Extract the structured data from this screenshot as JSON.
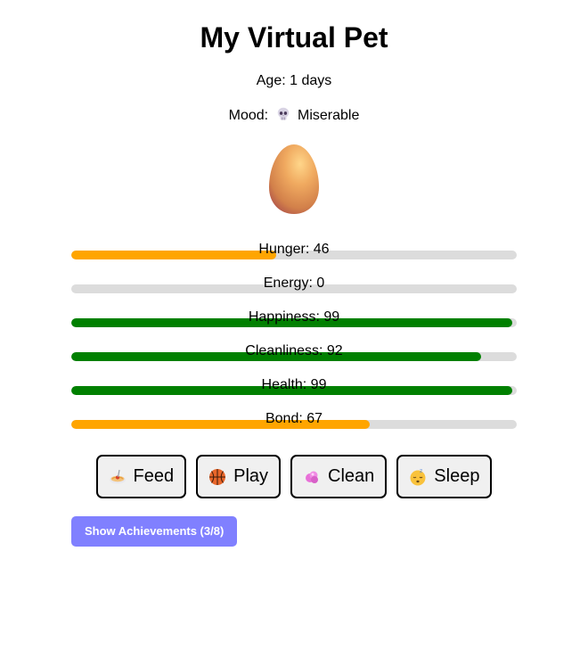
{
  "app": {
    "title": "My Virtual Pet"
  },
  "pet": {
    "age_text": "Age: 1 days",
    "mood_label": "Mood:",
    "mood_icon": "skull-icon",
    "mood_value": "Miserable",
    "avatar": "egg-icon"
  },
  "stats": [
    {
      "label": "Hunger: 46",
      "name": "Hunger",
      "value": 46,
      "max": 100,
      "color": "#ffa500"
    },
    {
      "label": "Energy: 0",
      "name": "Energy",
      "value": 0,
      "max": 100,
      "color": "#ffa500"
    },
    {
      "label": "Happiness: 99",
      "name": "Happiness",
      "value": 99,
      "max": 100,
      "color": "#008000"
    },
    {
      "label": "Cleanliness: 92",
      "name": "Cleanliness",
      "value": 92,
      "max": 100,
      "color": "#008000"
    },
    {
      "label": "Health: 99",
      "name": "Health",
      "value": 99,
      "max": 100,
      "color": "#008000"
    },
    {
      "label": "Bond: 67",
      "name": "Bond",
      "value": 67,
      "max": 100,
      "color": "#ffa500"
    }
  ],
  "actions": [
    {
      "label": "Feed",
      "icon": "spaghetti-icon"
    },
    {
      "label": "Play",
      "icon": "basketball-icon"
    },
    {
      "label": "Clean",
      "icon": "sponge-icon"
    },
    {
      "label": "Sleep",
      "icon": "sleeping-face-icon"
    }
  ],
  "achievements_button": "Show Achievements (3/8)",
  "colors": {
    "track": "#dcdcdc",
    "achievements_bg": "#8080ff",
    "button_bg": "#f0f0f0"
  }
}
